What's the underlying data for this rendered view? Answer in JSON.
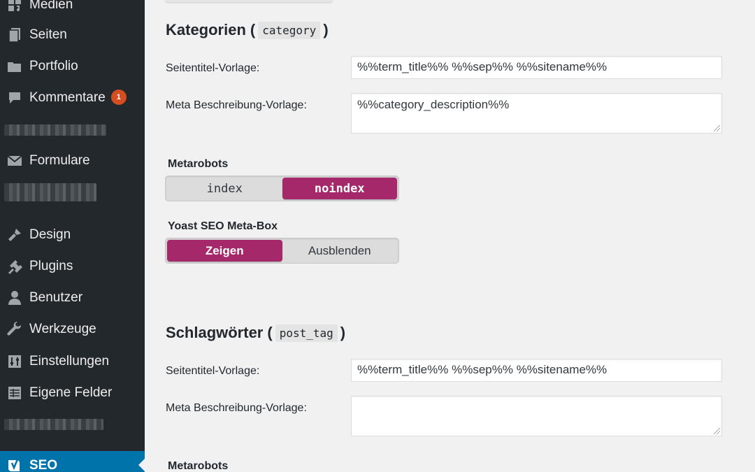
{
  "sidebar": {
    "items": [
      {
        "label": "Medien",
        "icon": "media-icon"
      },
      {
        "label": "Seiten",
        "icon": "pages-icon"
      },
      {
        "label": "Portfolio",
        "icon": "folder-icon"
      },
      {
        "label": "Kommentare",
        "icon": "comment-icon",
        "badge": "1"
      },
      {
        "label": "Formulare",
        "icon": "mail-icon"
      },
      {
        "label": "Design",
        "icon": "brush-icon"
      },
      {
        "label": "Plugins",
        "icon": "plugin-icon"
      },
      {
        "label": "Benutzer",
        "icon": "user-icon"
      },
      {
        "label": "Werkzeuge",
        "icon": "wrench-icon"
      },
      {
        "label": "Einstellungen",
        "icon": "sliders-icon"
      },
      {
        "label": "Eigene Felder",
        "icon": "table-icon"
      },
      {
        "label": "SEO",
        "icon": "yoast-icon"
      }
    ],
    "active_color": "#0073aa"
  },
  "sections": [
    {
      "title": "Kategorien",
      "taxonomy": "category",
      "title_label": "Seitentitel-Vorlage:",
      "title_value": "%%term_title%% %%sep%% %%sitename%%",
      "desc_label": "Meta Beschreibung-Vorlage:",
      "desc_value": "%%category_description%%",
      "metarobots_label": "Metarobots",
      "metarobots_options": [
        "index",
        "noindex"
      ],
      "metarobots_selected": "noindex",
      "metabox_label": "Yoast SEO Meta-Box",
      "metabox_options": [
        "Zeigen",
        "Ausblenden"
      ],
      "metabox_selected": "Zeigen"
    },
    {
      "title": "Schlagwörter",
      "taxonomy": "post_tag",
      "title_label": "Seitentitel-Vorlage:",
      "title_value": "%%term_title%% %%sep%% %%sitename%%",
      "desc_label": "Meta Beschreibung-Vorlage:",
      "desc_value": "",
      "metarobots_label": "Metarobots"
    }
  ],
  "accent_color": "#a4286a"
}
